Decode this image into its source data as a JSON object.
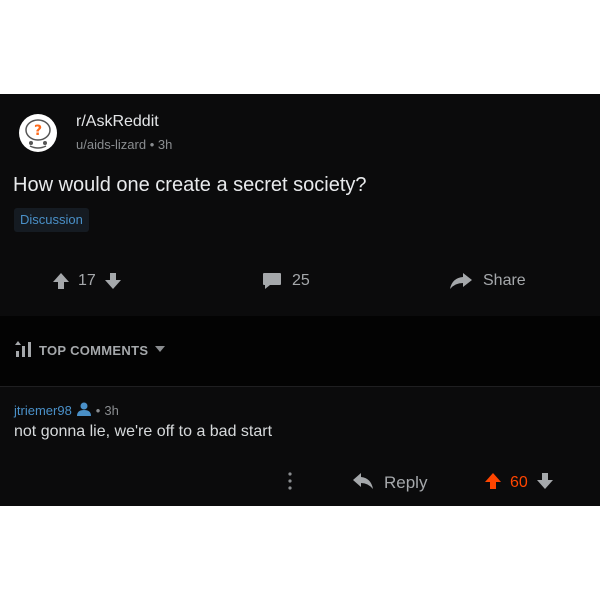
{
  "post": {
    "subreddit": "r/AskReddit",
    "author": "u/aids-lizard",
    "separator": "•",
    "age": "3h",
    "title": "How would one create a secret society?",
    "flair": "Discussion",
    "icon": "askreddit-snoo-icon"
  },
  "actions": {
    "vote_count": "17",
    "comment_count": "25",
    "share_label": "Share"
  },
  "sort": {
    "label": "TOP COMMENTS"
  },
  "comment": {
    "author": "jtriemer98",
    "separator": "•",
    "age": "3h",
    "body": "not gonna lie, we're off to a bad start",
    "reply_label": "Reply",
    "vote_count": "60"
  },
  "colors": {
    "background": "#0b0b0c",
    "accent_blue": "#4a90c8",
    "upvote_orange": "#ff4500",
    "muted_text": "#a5a8ab"
  }
}
